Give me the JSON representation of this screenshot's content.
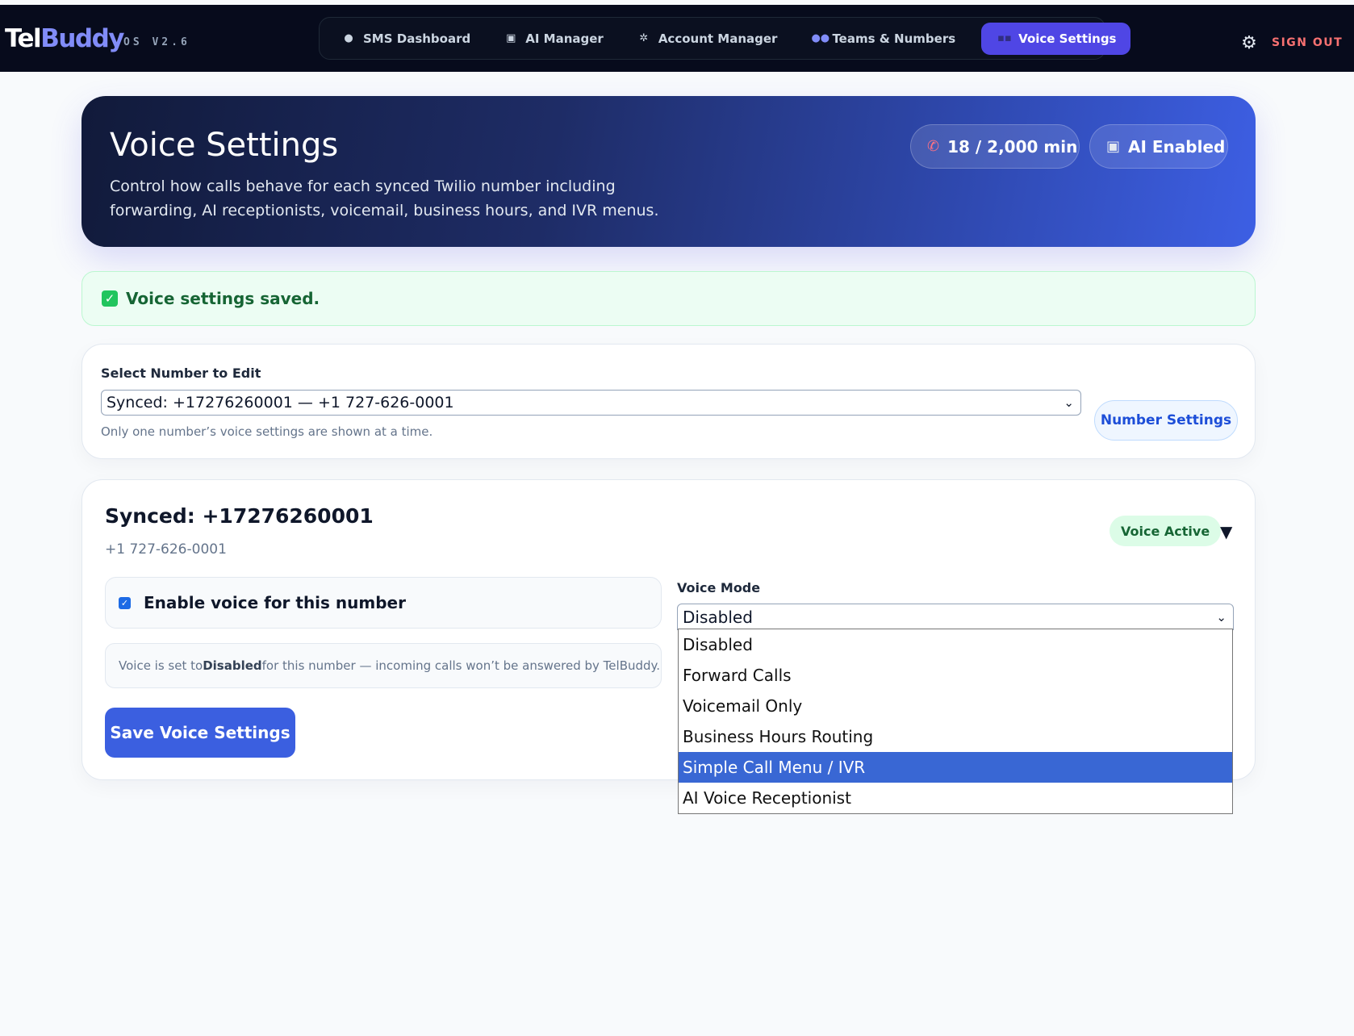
{
  "brand": {
    "name_part1": "Tel",
    "name_part2": "Buddy",
    "version": "OS V2.6"
  },
  "nav": {
    "tabs": [
      {
        "label": "SMS Dashboard",
        "icon": "speech-bubble-icon"
      },
      {
        "label": "AI Manager",
        "icon": "robot-icon"
      },
      {
        "label": "Account Manager",
        "icon": "gear-icon"
      },
      {
        "label": "Teams & Numbers",
        "icon": "people-icon"
      },
      {
        "label": "Voice Settings",
        "icon": "phone-icon",
        "active": true
      }
    ],
    "sign_out": "SIGN OUT"
  },
  "hero": {
    "title": "Voice Settings",
    "description": "Control how calls behave for each synced Twilio number including forwarding, AI receptionists, voicemail, business hours, and IVR menus.",
    "minutes_pill": "18 / 2,000 min",
    "ai_pill": "AI Enabled"
  },
  "alert": {
    "text": "Voice settings saved."
  },
  "selector": {
    "label": "Select Number to Edit",
    "selected": "Synced: +17276260001 — +1 727-626-0001",
    "hint": "Only one number’s voice settings are shown at a time.",
    "number_settings_button": "Number Settings"
  },
  "number_card": {
    "title": "Synced: +17276260001",
    "subtitle": "+1 727-626-0001",
    "status_badge": "Voice Active",
    "enable_label": "Enable voice for this number",
    "enable_checked": true,
    "voice_mode_label": "Voice Mode",
    "voice_mode_value": "Disabled",
    "info_prefix": "Voice is set to ",
    "info_bold": "Disabled",
    "info_suffix": " for this number — incoming calls won’t be answered by TelBuddy. Pick a Vo",
    "save_button": "Save Voice Settings"
  },
  "voice_mode_options": [
    {
      "label": "Disabled"
    },
    {
      "label": "Forward Calls"
    },
    {
      "label": "Voicemail Only"
    },
    {
      "label": "Business Hours Routing"
    },
    {
      "label": "Simple Call Menu / IVR",
      "highlighted": true
    },
    {
      "label": "AI Voice Receptionist"
    }
  ],
  "colors": {
    "accent": "#4f46e5",
    "primary_button": "#3b5fe0",
    "success": "#166534",
    "danger": "#f87171",
    "dropdown_highlight": "#3967d4"
  }
}
